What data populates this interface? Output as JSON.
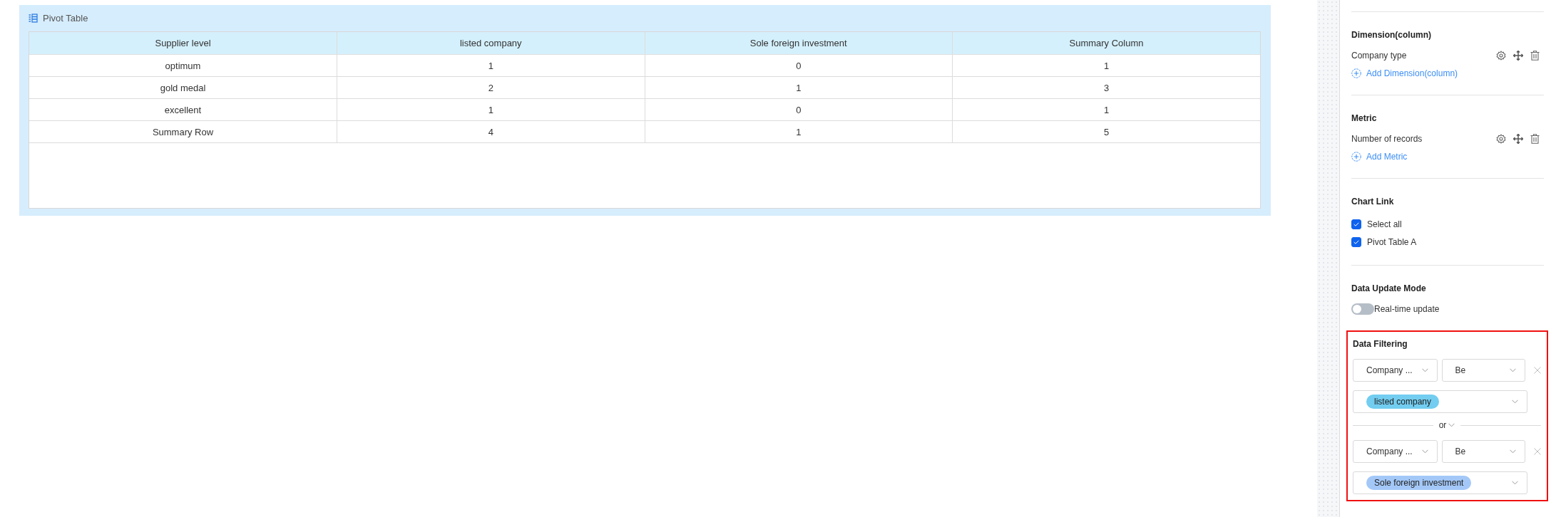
{
  "card": {
    "title": "Pivot Table"
  },
  "table": {
    "columns": [
      "Supplier level",
      "listed company",
      "Sole foreign investment",
      "Summary Column"
    ],
    "rows": [
      [
        "optimum",
        "1",
        "0",
        "1"
      ],
      [
        "gold medal",
        "2",
        "1",
        "3"
      ],
      [
        "excellent",
        "1",
        "0",
        "1"
      ],
      [
        "Summary Row",
        "4",
        "1",
        "5"
      ]
    ]
  },
  "panel": {
    "groups": [
      {
        "heading": "Dimension(column)",
        "fields": [
          {
            "label": "Company type"
          }
        ],
        "add_label": "Add Dimension(column)"
      },
      {
        "heading": "Metric",
        "fields": [
          {
            "label": "Number of records"
          }
        ],
        "add_label": "Add Metric"
      }
    ],
    "chart_link": {
      "heading": "Chart Link",
      "options": [
        {
          "label": "Select all",
          "checked": true
        },
        {
          "label": "Pivot Table A",
          "checked": true
        }
      ]
    },
    "update_mode": {
      "heading": "Data Update Mode",
      "toggle": {
        "label": "Real-time update",
        "on": false
      }
    },
    "filtering": {
      "heading": "Data Filtering",
      "joiner": "or",
      "conditions": [
        {
          "field": "Company ...",
          "operator": "Be",
          "values": [
            {
              "label": "listed company",
              "color": "#72cdf0"
            }
          ]
        },
        {
          "field": "Company ...",
          "operator": "Be",
          "values": [
            {
              "label": "Sole foreign investment",
              "color": "#a3c8f8"
            }
          ]
        }
      ]
    }
  }
}
